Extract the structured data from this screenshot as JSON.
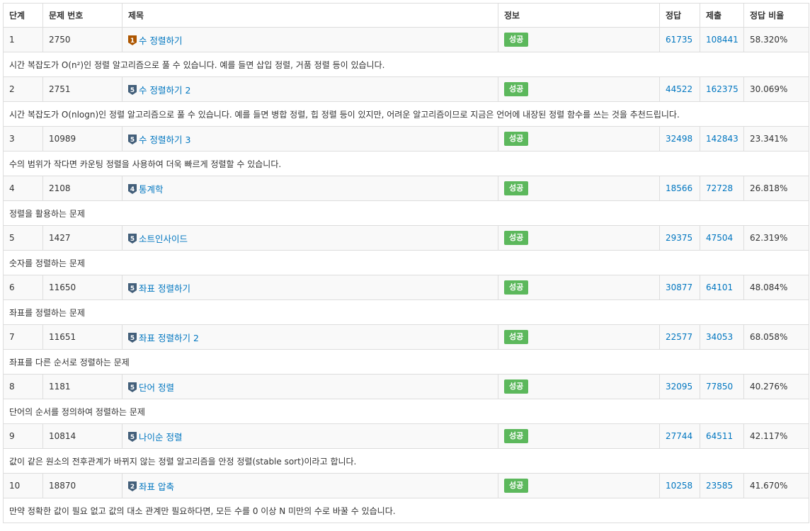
{
  "headers": {
    "step": "단계",
    "problem_id": "문제 번호",
    "title": "제목",
    "info": "정보",
    "accepted": "정답",
    "submissions": "제출",
    "ratio": "정답 비율"
  },
  "tier_colors": {
    "bronze": "#ad5600",
    "silver": "#435f7a"
  },
  "status_color": "#5cb85c",
  "link_color": "#0076c0",
  "rows": [
    {
      "step": "1",
      "id": "2750",
      "tier": "bronze",
      "level": "1",
      "title": "수 정렬하기",
      "status": "성공",
      "accepted": "61735",
      "submissions": "108441",
      "ratio": "58.320%",
      "desc": "시간 복잡도가 O(n²)인 정렬 알고리즘으로 풀 수 있습니다. 예를 들면 삽입 정렬, 거품 정렬 등이 있습니다."
    },
    {
      "step": "2",
      "id": "2751",
      "tier": "silver",
      "level": "5",
      "title": "수 정렬하기 2",
      "status": "성공",
      "accepted": "44522",
      "submissions": "162375",
      "ratio": "30.069%",
      "desc": "시간 복잡도가 O(nlogn)인 정렬 알고리즘으로 풀 수 있습니다. 예를 들면 병합 정렬, 힙 정렬 등이 있지만, 어려운 알고리즘이므로 지금은 언어에 내장된 정렬 함수를 쓰는 것을 추천드립니다."
    },
    {
      "step": "3",
      "id": "10989",
      "tier": "silver",
      "level": "5",
      "title": "수 정렬하기 3",
      "status": "성공",
      "accepted": "32498",
      "submissions": "142843",
      "ratio": "23.341%",
      "desc": "수의 범위가 작다면 카운팅 정렬을 사용하여 더욱 빠르게 정렬할 수 있습니다."
    },
    {
      "step": "4",
      "id": "2108",
      "tier": "silver",
      "level": "4",
      "title": "통계학",
      "status": "성공",
      "accepted": "18566",
      "submissions": "72728",
      "ratio": "26.818%",
      "desc": "정렬을 활용하는 문제"
    },
    {
      "step": "5",
      "id": "1427",
      "tier": "silver",
      "level": "5",
      "title": "소트인사이드",
      "status": "성공",
      "accepted": "29375",
      "submissions": "47504",
      "ratio": "62.319%",
      "desc": "숫자를 정렬하는 문제"
    },
    {
      "step": "6",
      "id": "11650",
      "tier": "silver",
      "level": "5",
      "title": "좌표 정렬하기",
      "status": "성공",
      "accepted": "30877",
      "submissions": "64101",
      "ratio": "48.084%",
      "desc": "좌표를 정렬하는 문제"
    },
    {
      "step": "7",
      "id": "11651",
      "tier": "silver",
      "level": "5",
      "title": "좌표 정렬하기 2",
      "status": "성공",
      "accepted": "22577",
      "submissions": "34053",
      "ratio": "68.058%",
      "desc": "좌표를 다른 순서로 정렬하는 문제"
    },
    {
      "step": "8",
      "id": "1181",
      "tier": "silver",
      "level": "5",
      "title": "단어 정렬",
      "status": "성공",
      "accepted": "32095",
      "submissions": "77850",
      "ratio": "40.276%",
      "desc": "단어의 순서를 정의하여 정렬하는 문제"
    },
    {
      "step": "9",
      "id": "10814",
      "tier": "silver",
      "level": "5",
      "title": "나이순 정렬",
      "status": "성공",
      "accepted": "27744",
      "submissions": "64511",
      "ratio": "42.117%",
      "desc": "값이 같은 원소의 전후관계가 바뀌지 않는 정렬 알고리즘을 안정 정렬(stable sort)이라고 합니다."
    },
    {
      "step": "10",
      "id": "18870",
      "tier": "silver",
      "level": "2",
      "title": "좌표 압축",
      "status": "성공",
      "accepted": "10258",
      "submissions": "23585",
      "ratio": "41.670%",
      "desc": "만약 정확한 값이 필요 없고 값의 대소 관계만 필요하다면, 모든 수를 0 이상 N 미만의 수로 바꿀 수 있습니다."
    }
  ]
}
